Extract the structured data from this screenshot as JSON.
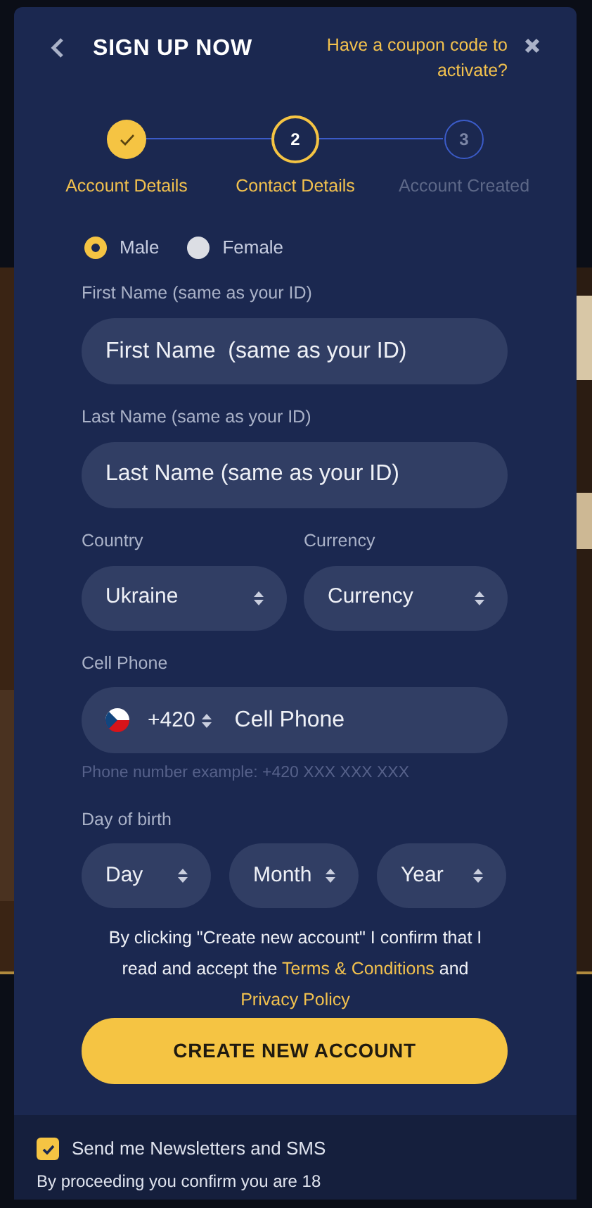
{
  "header": {
    "title": "SIGN UP NOW",
    "coupon_link": "Have a coupon code to activate?"
  },
  "steps": [
    {
      "label": "Account Details",
      "kind": "done"
    },
    {
      "label": "Contact Details",
      "number": "2",
      "kind": "current"
    },
    {
      "label": "Account Created",
      "number": "3",
      "kind": "pending"
    }
  ],
  "gender": [
    {
      "label": "Male",
      "selected": true
    },
    {
      "label": "Female",
      "selected": false
    }
  ],
  "first_name": {
    "label": "First Name (same as your ID)",
    "placeholder": "First Name  (same as your ID)"
  },
  "last_name": {
    "label": "Last Name (same as your ID)",
    "placeholder": "Last Name (same as your ID)"
  },
  "country": {
    "label": "Country",
    "value": "Ukraine"
  },
  "currency": {
    "label": "Currency",
    "value": "Currency"
  },
  "phone": {
    "label": "Cell Phone",
    "code": "+420",
    "placeholder": "Cell Phone",
    "hint": "Phone number example: +420 XXX XXX XXX"
  },
  "birth": {
    "label": "Day of birth",
    "selects": [
      "Day",
      "Month",
      "Year"
    ]
  },
  "consent": {
    "before": "By clicking \"Create new account\" I confirm that I read and accept the ",
    "terms_link": "Terms & Conditions",
    "middle": " and ",
    "privacy_link": "Privacy Policy"
  },
  "submit": "CREATE NEW ACCOUNT",
  "newsletter": {
    "label": "Send me Newsletters and SMS",
    "checked": true
  },
  "footer_note": "By proceeding you confirm you are 18"
}
